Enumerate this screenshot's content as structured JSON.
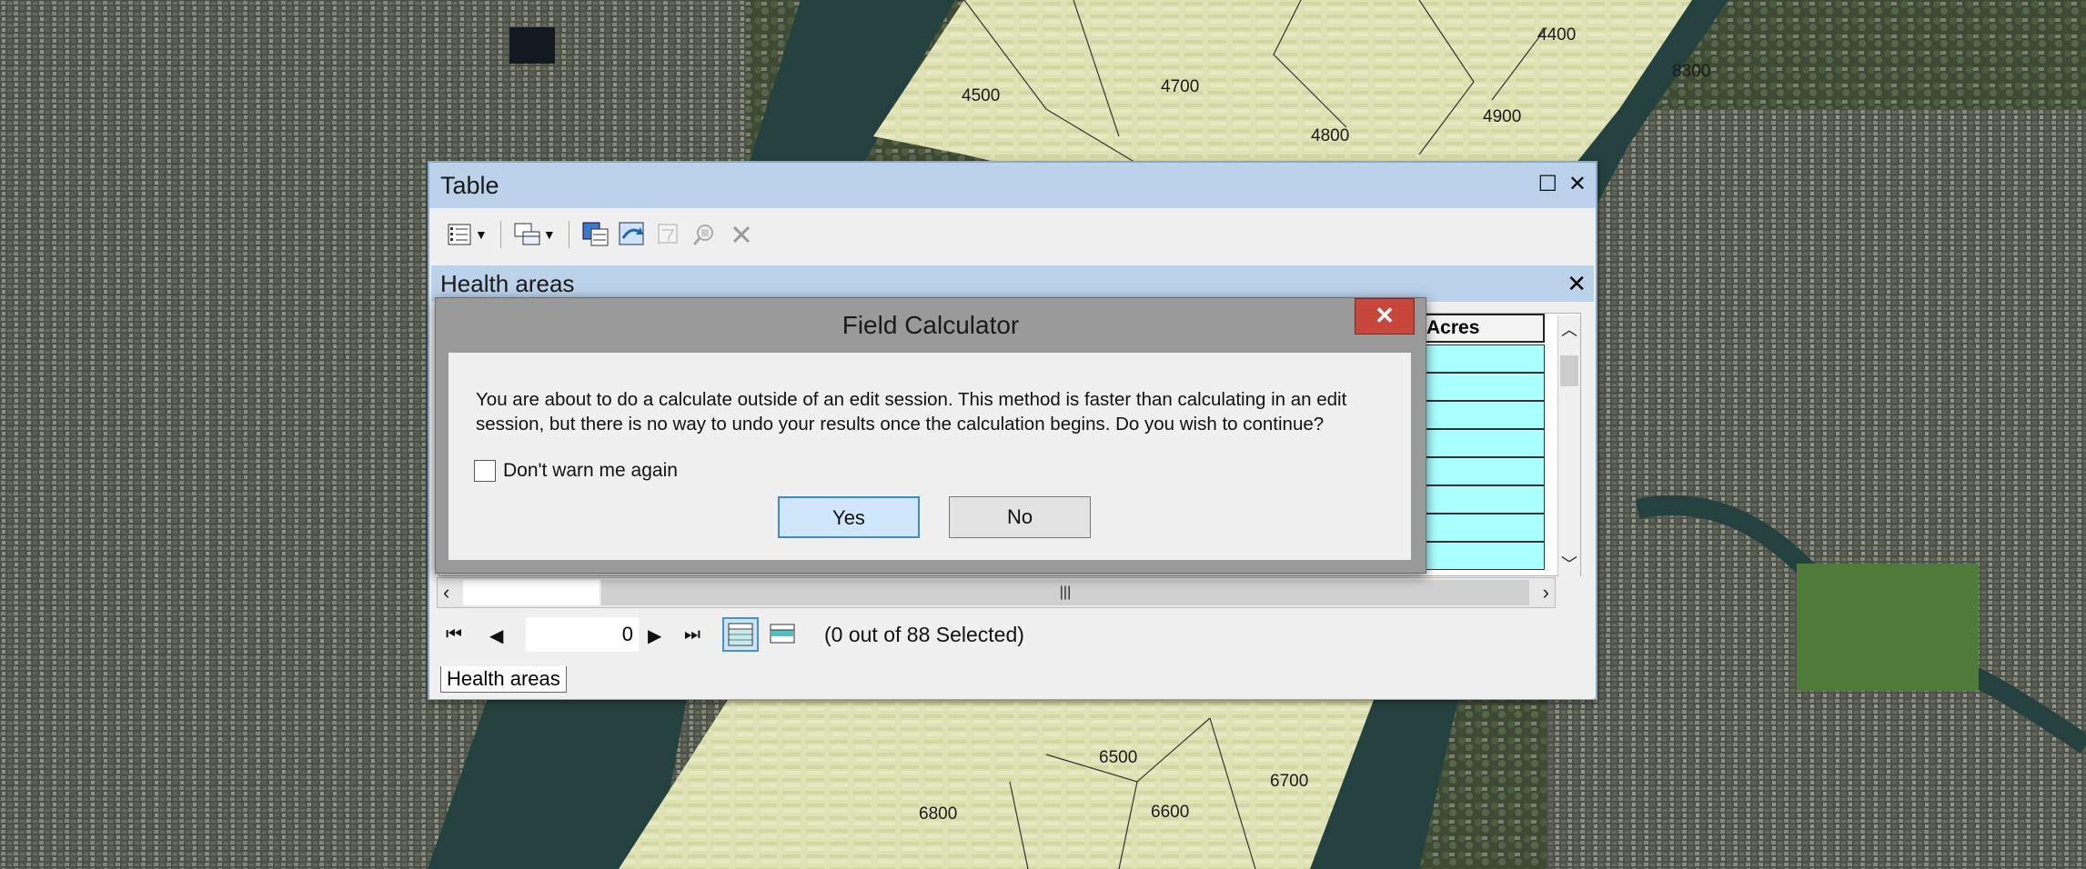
{
  "map": {
    "labels": [
      "4500",
      "4700",
      "4400",
      "8300",
      "4800",
      "4900",
      "6500",
      "6700",
      "6800",
      "6600"
    ]
  },
  "table_window": {
    "title": "Table",
    "maximize_symbol": "☐",
    "close_symbol": "✕",
    "toolbar": {
      "icons": [
        "table-options-icon",
        "related-tables-icon",
        "select-by-attributes-icon",
        "switch-selection-icon",
        "clear-selection-icon",
        "zoom-to-selected-icon",
        "delete-selected-icon"
      ]
    },
    "subtable_title": "Health areas",
    "column_header": "Acres",
    "nav": {
      "record_value": "0",
      "selection_status": "(0 out of 88 Selected)",
      "first": "⏮",
      "prev": "◀",
      "next": "▶",
      "last": "⏭"
    },
    "tab_label": "Health areas"
  },
  "dialog": {
    "title": "Field Calculator",
    "close_label": "✕",
    "message": "You are about to do a calculate outside of an edit session. This method is faster than calculating in an edit session, but there is no way to undo your results once the calculation begins. Do you wish to continue?",
    "checkbox_label": "Don't warn me again",
    "checkbox_checked": false,
    "yes_label": "Yes",
    "no_label": "No"
  },
  "colors": {
    "title_bar": "#bcd2ea",
    "dialog_close": "#c7473d",
    "selected_cell": "#aaffff",
    "yes_button": "#cfe6fb"
  }
}
